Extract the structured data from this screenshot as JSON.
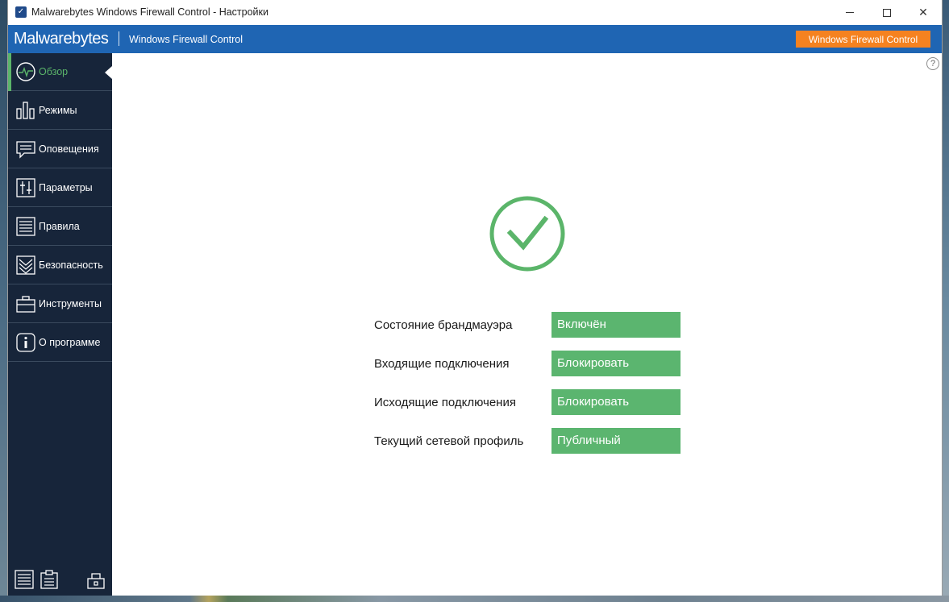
{
  "window": {
    "title": "Malwarebytes Windows Firewall Control - Настройки"
  },
  "header": {
    "brand": "Malwarebytes",
    "product": "Windows Firewall Control",
    "button_label": "Windows Firewall Control",
    "accent": "#1f65b3",
    "button_color": "#f58220"
  },
  "sidebar": {
    "items": [
      {
        "label": "Обзор",
        "icon": "pulse-icon",
        "active": true
      },
      {
        "label": "Режимы",
        "icon": "bars-icon",
        "active": false
      },
      {
        "label": "Оповещения",
        "icon": "chat-icon",
        "active": false
      },
      {
        "label": "Параметры",
        "icon": "sliders-icon",
        "active": false
      },
      {
        "label": "Правила",
        "icon": "list-icon",
        "active": false
      },
      {
        "label": "Безопасность",
        "icon": "shield-icon",
        "active": false
      },
      {
        "label": "Инструменты",
        "icon": "toolbox-icon",
        "active": false
      },
      {
        "label": "О программе",
        "icon": "info-icon",
        "active": false
      }
    ],
    "bottom_icons": [
      "log-icon",
      "clipboard-icon",
      "lock-icon"
    ],
    "active_color": "#5bb56a"
  },
  "main": {
    "status_icon": "checkmark-circle-icon",
    "status_color": "#5bb56a",
    "rows": [
      {
        "label": "Состояние брандмауэра",
        "value": "Включён"
      },
      {
        "label": "Входящие подключения",
        "value": "Блокировать"
      },
      {
        "label": "Исходящие подключения",
        "value": "Блокировать"
      },
      {
        "label": "Текущий сетевой профиль",
        "value": "Публичный"
      }
    ]
  }
}
